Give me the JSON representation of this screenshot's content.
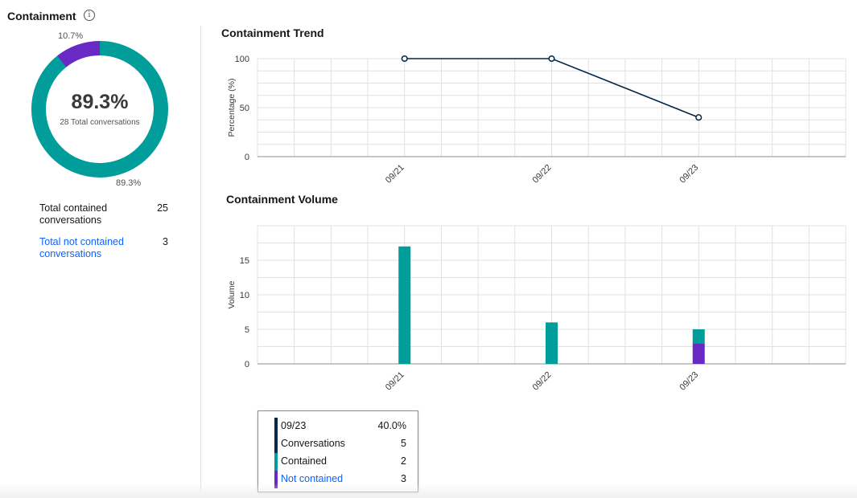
{
  "containment": {
    "title": "Containment",
    "info_icon": "info-icon",
    "donut": {
      "center_value": "89.3%",
      "center_caption": "28 Total conversations",
      "contained_label": "89.3%",
      "not_contained_label": "10.7%",
      "contained_fraction": 0.893,
      "not_contained_fraction": 0.107
    },
    "stats": [
      {
        "label": "Total contained conversations",
        "value": "25"
      },
      {
        "label": "Total not contained conversations",
        "value": "3"
      }
    ]
  },
  "colors": {
    "contained": "#009d9a",
    "not_contained": "#6929c4",
    "line": "#012749",
    "grid": "#e0e0e0",
    "link": "#0f62fe"
  },
  "chart_data": [
    {
      "type": "line",
      "title": "Containment Trend",
      "ylabel": "Percentage (%)",
      "xlabel": "",
      "categories": [
        "09/21",
        "09/22",
        "09/23"
      ],
      "y_ticks": [
        "100",
        "50",
        "0"
      ],
      "series": [
        {
          "values": [
            100,
            100,
            40
          ]
        }
      ],
      "ylim": [
        0,
        100
      ],
      "grid": true
    },
    {
      "type": "bar",
      "title": "Containment Volume",
      "ylabel": "Volume",
      "xlabel": "",
      "categories": [
        "09/21",
        "09/22",
        "09/23"
      ],
      "y_ticks": [
        "15",
        "10",
        "5",
        "0"
      ],
      "stacked": true,
      "series": [
        {
          "name": "Contained",
          "values": [
            17,
            6,
            2
          ]
        },
        {
          "name": "Not contained",
          "values": [
            0,
            0,
            3
          ]
        }
      ],
      "ylim": [
        0,
        19
      ],
      "grid": true
    }
  ],
  "tooltip": {
    "header_label": "09/23",
    "header_value": "40.0%",
    "rows": [
      {
        "label": "Conversations",
        "value": "5"
      },
      {
        "label": "Contained",
        "value": "2"
      },
      {
        "label": "Not contained",
        "value": "3"
      }
    ]
  }
}
